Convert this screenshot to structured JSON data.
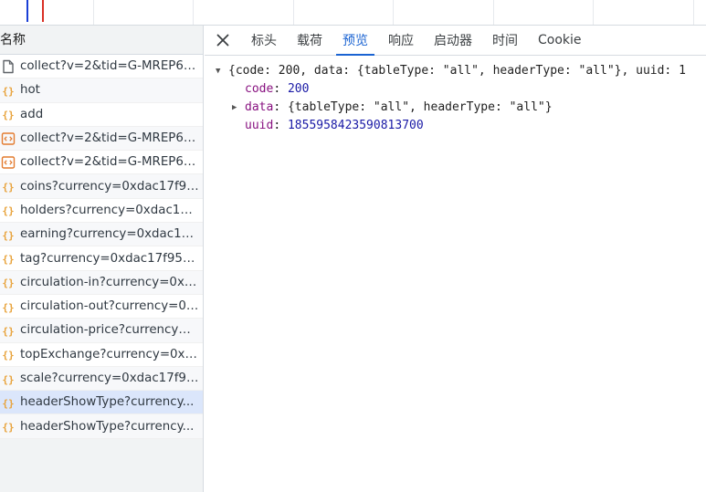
{
  "list": {
    "header": "名称",
    "requests": [
      {
        "name": "collect?v=2&tid=G-MREP6F...",
        "icon": "document-icon"
      },
      {
        "name": "hot",
        "icon": "xhr-icon"
      },
      {
        "name": "add",
        "icon": "xhr-icon"
      },
      {
        "name": "collect?v=2&tid=G-MREP6F...",
        "icon": "script-icon"
      },
      {
        "name": "collect?v=2&tid=G-MREP6F...",
        "icon": "script-icon"
      },
      {
        "name": "coins?currency=0xdac17f95...",
        "icon": "xhr-icon"
      },
      {
        "name": "holders?currency=0xdac17f...",
        "icon": "xhr-icon"
      },
      {
        "name": "earning?currency=0xdac17f...",
        "icon": "xhr-icon"
      },
      {
        "name": "tag?currency=0xdac17f958...",
        "icon": "xhr-icon"
      },
      {
        "name": "circulation-in?currency=0xd...",
        "icon": "xhr-icon"
      },
      {
        "name": "circulation-out?currency=0x...",
        "icon": "xhr-icon"
      },
      {
        "name": "circulation-price?currency=...",
        "icon": "xhr-icon"
      },
      {
        "name": "topExchange?currency=0xd...",
        "icon": "xhr-icon"
      },
      {
        "name": "scale?currency=0xdac17f95...",
        "icon": "xhr-icon"
      },
      {
        "name": "headerShowType?currency...",
        "icon": "xhr-icon",
        "selected": true
      },
      {
        "name": "headerShowType?currency...",
        "icon": "xhr-icon"
      }
    ]
  },
  "tabs": [
    {
      "label": "标头"
    },
    {
      "label": "载荷"
    },
    {
      "label": "预览",
      "active": true
    },
    {
      "label": "响应"
    },
    {
      "label": "启动器"
    },
    {
      "label": "时间"
    },
    {
      "label": "Cookie"
    }
  ],
  "preview": {
    "summary": "{code: 200, data: {tableType: \"all\", headerType: \"all\"}, uuid: 1",
    "code_key": "code",
    "code_value": "200",
    "data_key": "data",
    "data_value": "{tableType: \"all\", headerType: \"all\"}",
    "uuid_key": "uuid",
    "uuid_value": "1855958423590813700"
  },
  "colors": {
    "accent": "#1a63d2",
    "xhr_icon": "#e8a33c",
    "script_icon": "#e37b2f",
    "key": "#881280",
    "value": "#1a1aa6",
    "selected_row": "#dbe6fb"
  }
}
